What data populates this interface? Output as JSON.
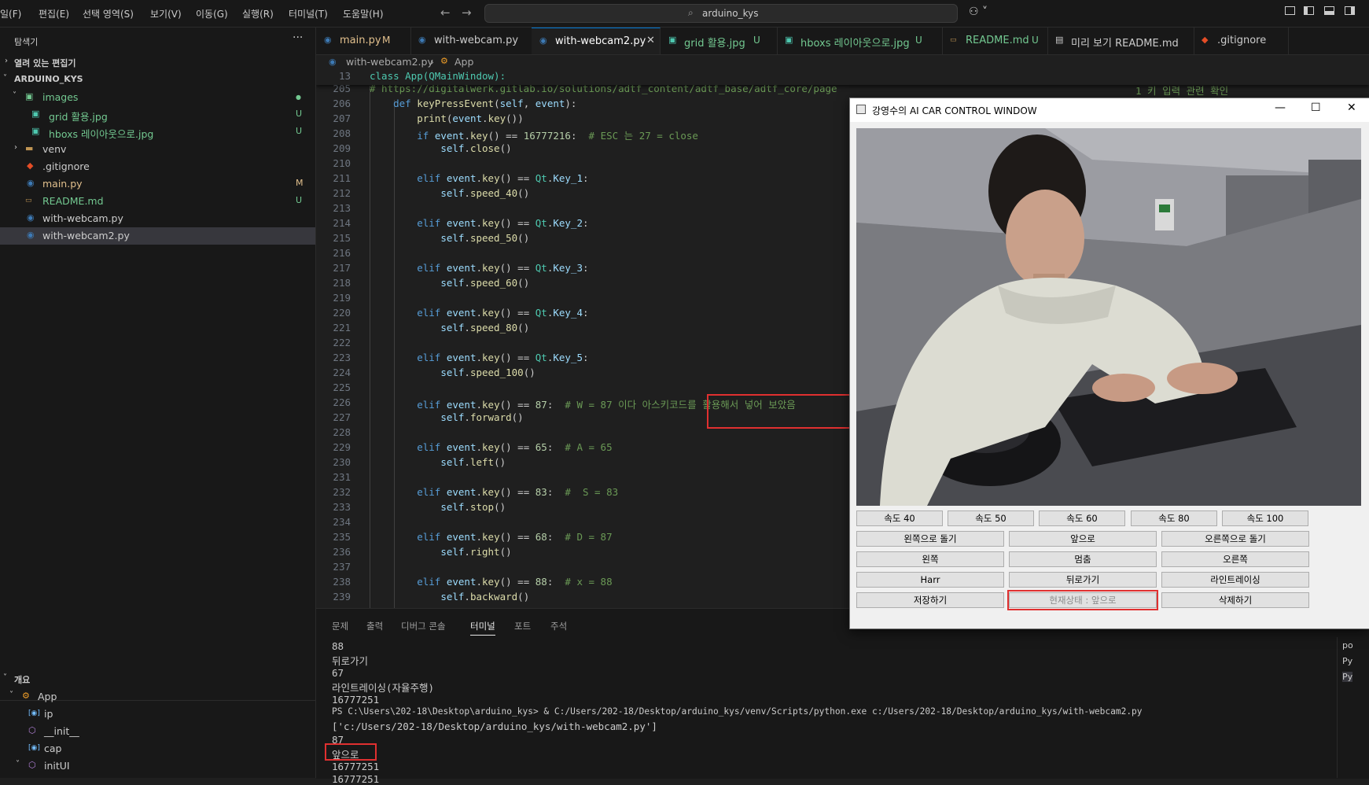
{
  "menubar": {
    "items": [
      "일(F)",
      "편집(E)",
      "선택 영역(S)",
      "보기(V)",
      "이동(G)",
      "실행(R)",
      "터미널(T)",
      "도움말(H)"
    ],
    "search_text": "arduino_kys"
  },
  "sidebar": {
    "title": "탐색기",
    "open_editors": "열려 있는 편집기",
    "root": "ARDUINO_KYS",
    "items": [
      {
        "label": "images",
        "badge": ""
      },
      {
        "label": "grid 활용.jpg",
        "badge": "U"
      },
      {
        "label": "hboxs 레이아웃으로.jpg",
        "badge": "U"
      },
      {
        "label": "venv",
        "badge": ""
      },
      {
        "label": ".gitignore",
        "badge": ""
      },
      {
        "label": "main.py",
        "badge": "M"
      },
      {
        "label": "README.md",
        "badge": "U"
      },
      {
        "label": "with-webcam.py",
        "badge": ""
      },
      {
        "label": "with-webcam2.py",
        "badge": ""
      }
    ],
    "outline": {
      "title": "개요",
      "items": [
        "App",
        "ip",
        "__init__",
        "cap",
        "initUI"
      ]
    }
  },
  "tabs": [
    {
      "label": "main.py",
      "status": "M"
    },
    {
      "label": "with-webcam.py",
      "status": ""
    },
    {
      "label": "with-webcam2.py",
      "status": ""
    },
    {
      "label": "grid 활용.jpg",
      "status": "U"
    },
    {
      "label": "hboxs 레이아웃으로.jpg",
      "status": "U"
    },
    {
      "label": "README.md",
      "status": "U"
    },
    {
      "label": "미리 보기 README.md",
      "status": ""
    },
    {
      "label": ".gitignore",
      "status": ""
    }
  ],
  "breadcrumb": {
    "file": "with-webcam2.py",
    "symbol": "App"
  },
  "editor": {
    "sticky_line_number": "13",
    "sticky_code": "class App(QMainWindow):",
    "url_line": "# https://digitalwerk.gitlab.io/solutions/adtf_content/adtf_base/adtf_core/page",
    "url_tail": "1 키 입력 관련 확인"
  },
  "panel": {
    "tabs": [
      "문제",
      "출력",
      "디버그 콘솔",
      "터미널",
      "포트",
      "주석"
    ],
    "terminal_lines": [
      "88",
      "뒤로가기",
      "67",
      "라인트레이싱(자율주행)",
      "16777251",
      "PS C:\\Users\\202-18\\Desktop\\arduino_kys> & C:/Users/202-18/Desktop/arduino_kys/venv/Scripts/python.exe c:/Users/202-18/Desktop/arduino_kys/with-webcam2.py",
      "['c:/Users/202-18/Desktop/arduino_kys/with-webcam2.py']",
      "87",
      "앞으로",
      "16777251",
      "16777251"
    ],
    "side_items": [
      "po",
      "Py",
      "Py"
    ]
  },
  "qt_window": {
    "title": "강영수의 AI CAR CONTROL WINDOW",
    "speed_buttons": [
      "속도 40",
      "속도 50",
      "속도 60",
      "속도 80",
      "속도 100"
    ],
    "grid_buttons": [
      [
        "왼쪽으로 돌기",
        "앞으로",
        "오른쪽으로 돌기"
      ],
      [
        "왼쪽",
        "멈춤",
        "오른쪽"
      ],
      [
        "Harr",
        "뒤로가기",
        "라인트레이싱"
      ],
      [
        "저장하기",
        "현재상태 : 앞으로",
        "삭제하기"
      ]
    ]
  },
  "colors": {
    "accent": "#0078d4",
    "highlight": "#e03030",
    "modified": "#e2c08d",
    "untracked": "#73c991"
  }
}
